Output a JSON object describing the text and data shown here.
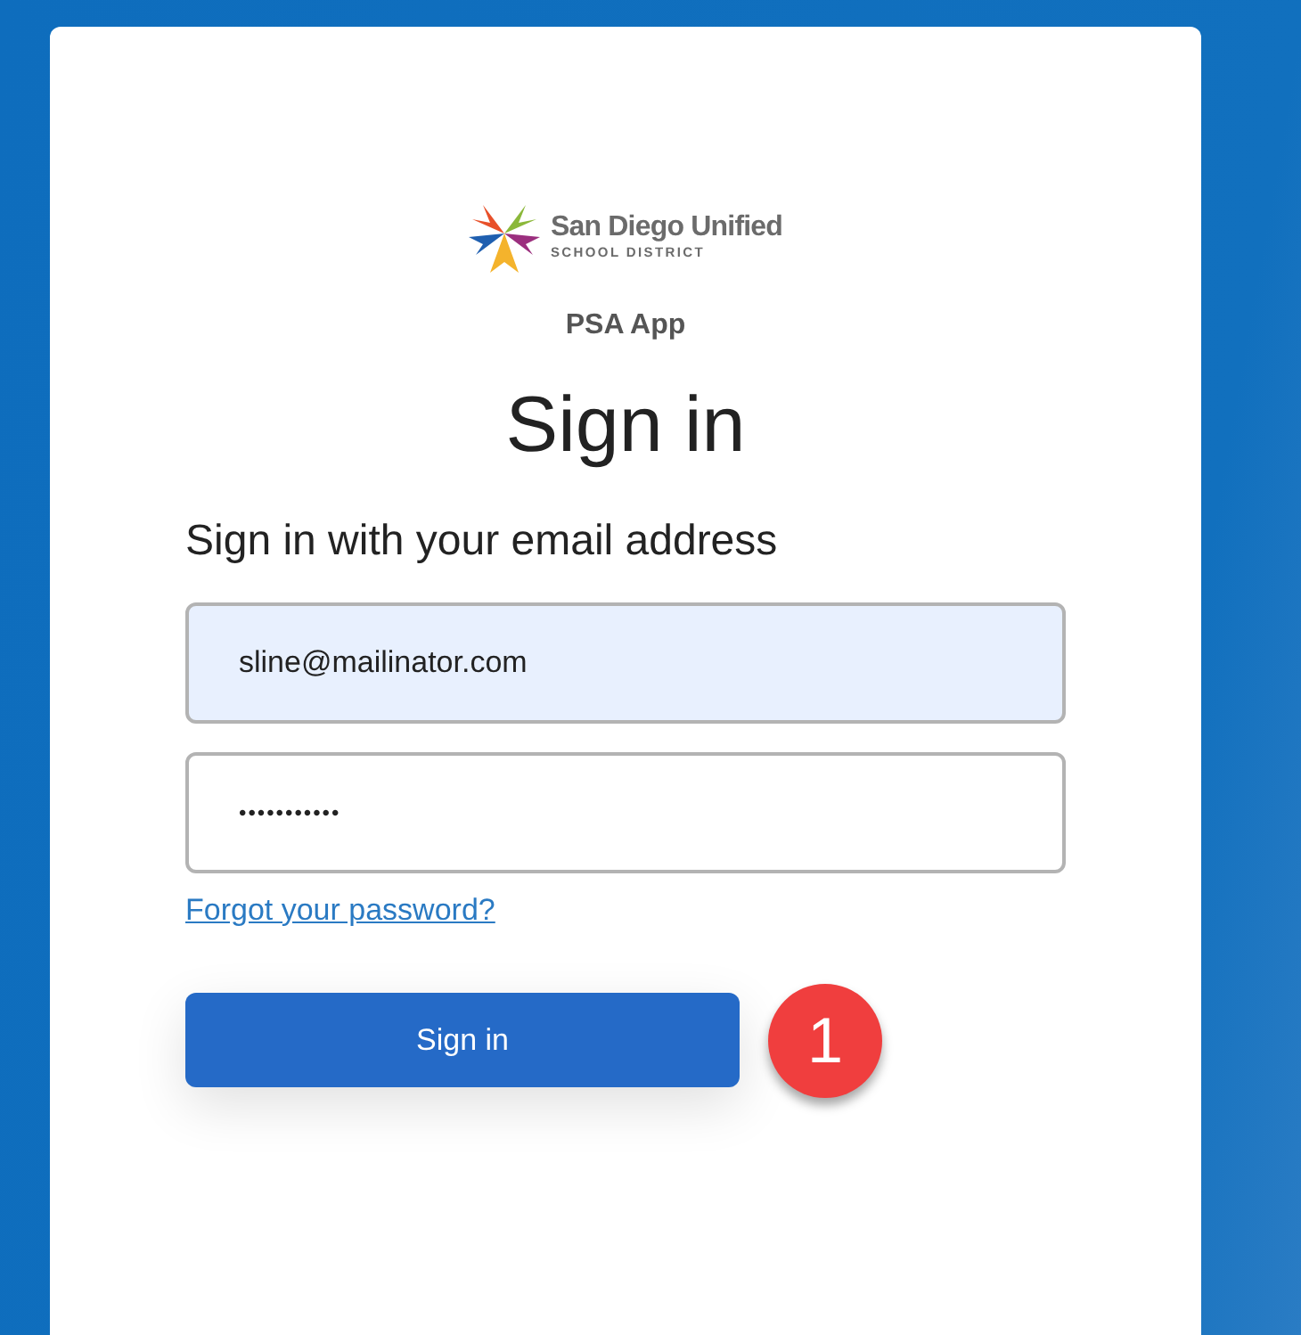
{
  "logo": {
    "name": "San Diego Unified",
    "subtitle": "SCHOOL DISTRICT"
  },
  "app_name": "PSA App",
  "heading": "Sign in",
  "subheading": "Sign in with your email address",
  "fields": [
    {
      "kind": "email",
      "value": "sline@mailinator.com",
      "autofilled": true
    },
    {
      "kind": "password",
      "value": "•••••••••••",
      "autofilled": false
    }
  ],
  "forgot_link": "Forgot your password?",
  "submit_button": "Sign in",
  "step_badge": "1"
}
